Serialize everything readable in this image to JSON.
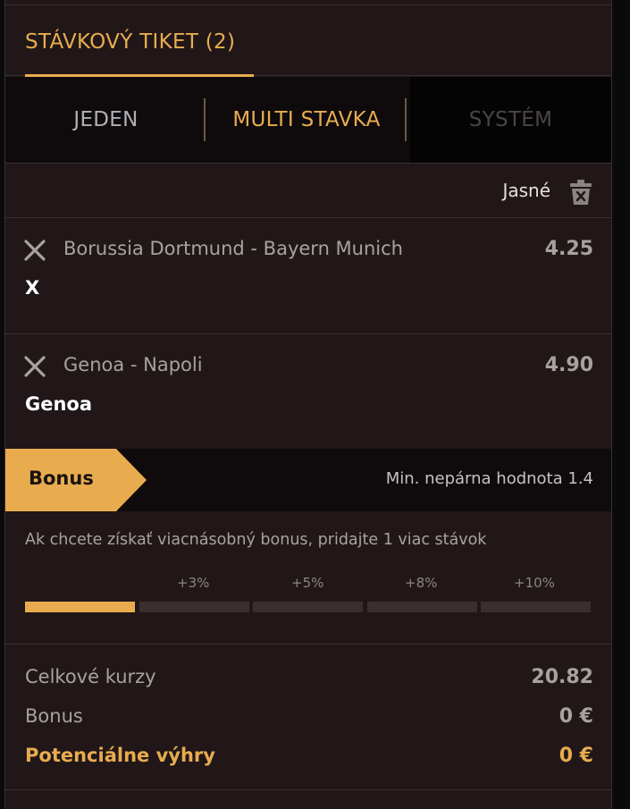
{
  "ticket": {
    "title": "STÁVKOVÝ TIKET (2)"
  },
  "tabs": [
    {
      "label": "JEDEN"
    },
    {
      "label": "MULTI STAVKA"
    },
    {
      "label": "SYSTÉM"
    }
  ],
  "clear": {
    "label": "Jasné",
    "icon": "trash-icon"
  },
  "bets": [
    {
      "match": "Borussia Dortmund - Bayern Munich",
      "odd": "4.25",
      "pick": "X"
    },
    {
      "match": "Genoa - Napoli",
      "odd": "4.90",
      "pick": "Genoa"
    }
  ],
  "bonus": {
    "tag": "Bonus",
    "min_odd": "Min. nepárna hodnota 1.4",
    "info": "Ak chcete získať viacnásobný bonus, pridajte 1 viac stávok",
    "levels": [
      "+3%",
      "+5%",
      "+8%",
      "+10%"
    ],
    "progress_filled_segments": 1,
    "progress_total_segments": 5
  },
  "summary": {
    "total_odds_label": "Celkové kurzy",
    "total_odds_value": "20.82",
    "bonus_label": "Bonus",
    "bonus_value": "0 €",
    "potential_label": "Potenciálne výhry",
    "potential_value": "0 €"
  },
  "colors": {
    "accent": "#e8ac4f",
    "panel": "#211718",
    "dark": "#0f0b0c"
  }
}
